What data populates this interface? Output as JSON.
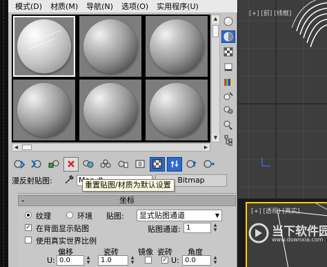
{
  "menubar": {
    "items": [
      "模式(D)",
      "材质(M)",
      "导航(N)",
      "选项(O)",
      "实用程序(U)"
    ]
  },
  "map_row": {
    "label": "漫反射贴图:",
    "name_value": "Map #",
    "type_button": "Bitmap"
  },
  "tooltip": "重置贴图/材质为默认设置",
  "rollout": {
    "title": "坐标",
    "collapse_glyph": "-",
    "radio_texture": "纹理",
    "radio_environment": "环境",
    "mapping_label": "贴图:",
    "mapping_value": "显式贴图通道",
    "show_map_on_back": "在背面显示贴图",
    "map_channel_label": "贴图通道:",
    "map_channel_value": "1",
    "use_real_world_scale": "使用真实世界比例",
    "col_offset": "偏移",
    "col_tiling": "瓷砖",
    "col_mirror": "镜像",
    "col_tile": "瓷砖",
    "col_angle": "角度",
    "row_u_label": "U:",
    "u_offset": "0.0",
    "u_tiling": "1.0",
    "u_angle_label": "U:",
    "u_angle": "0.0"
  },
  "viewports": {
    "top_label": "[+] [前] [线框]",
    "persp_label": "[+] [透视] [真实]"
  },
  "watermark": {
    "title": "当下软件园",
    "url": "www.downxia.com"
  },
  "colors": {
    "accent_blue": "#2d6bd1",
    "viewport_bg": "#3d3d3d",
    "active_viewport_border": "#ffd000",
    "tooltip_bg": "#ffffe1"
  },
  "icons": {
    "side": [
      "sample-type-icon",
      "backlight-icon",
      "background-icon",
      "uv-tiling-icon",
      "video-color-check-icon",
      "make-preview-icon",
      "options-icon",
      "select-by-material-icon",
      "material-map-navigator-icon"
    ],
    "bottom": [
      "get-material-icon",
      "put-to-scene-icon",
      "assign-to-selection-icon",
      "reset-map-icon",
      "make-copy-icon",
      "make-unique-icon",
      "put-to-library-icon",
      "material-id-channel-icon",
      "show-shaded-in-viewport-icon",
      "show-end-result-icon",
      "go-to-parent-icon",
      "go-forward-to-sibling-icon"
    ]
  }
}
